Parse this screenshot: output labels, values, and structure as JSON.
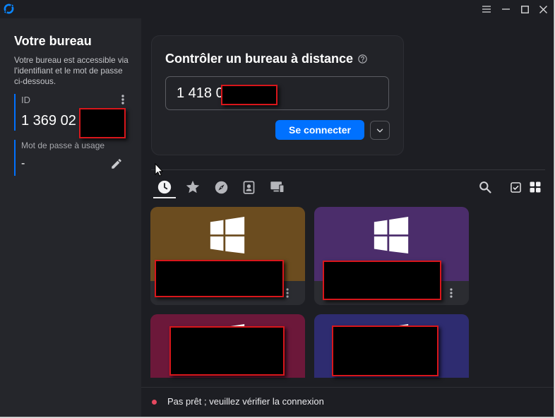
{
  "window": {
    "app_icon": "rustdesk-logo-icon",
    "controls": [
      "menu-icon",
      "minimize-icon",
      "maximize-icon",
      "close-icon"
    ]
  },
  "sidebar": {
    "title": "Votre bureau",
    "description": "Votre bureau est accessible via l'identifiant et le mot de passe ci-dessous.",
    "id": {
      "label": "ID",
      "value": "1 369 02",
      "menu_icon": "more-vert-icon"
    },
    "password": {
      "label": "Mot de passe à usage",
      "value": "-",
      "edit_icon": "pencil-icon"
    }
  },
  "connect": {
    "title": "Contrôler un bureau à distance",
    "help_icon": "help-icon",
    "remote_id_value": "1 418 0",
    "button_label": "Se connecter",
    "options_icon": "chevron-down-icon"
  },
  "peer_tabs": [
    {
      "icon": "clock-icon",
      "active": true
    },
    {
      "icon": "star-icon",
      "active": false
    },
    {
      "icon": "compass-icon",
      "active": false
    },
    {
      "icon": "address-book-icon",
      "active": false
    },
    {
      "icon": "devices-icon",
      "active": false
    }
  ],
  "peer_tools": [
    "search-icon",
    "checkbox-icon",
    "grid-view-icon"
  ],
  "peers": [
    {
      "os_icon": "windows-logo-icon",
      "color": "#6b4c1f"
    },
    {
      "os_icon": "windows-logo-icon",
      "color": "#4b2d6b"
    },
    {
      "os_icon": "windows-logo-icon",
      "color": "#6c183a"
    },
    {
      "os_icon": "windows-logo-icon",
      "color": "#2e2c70"
    }
  ],
  "status": {
    "text": "Pas prêt ; veuillez vérifier la connexion",
    "indicator_color": "#e5485f"
  },
  "theme": {
    "accent": "#0071ff",
    "sidebar_bg": "#25262b",
    "main_bg": "#1d1e23"
  }
}
